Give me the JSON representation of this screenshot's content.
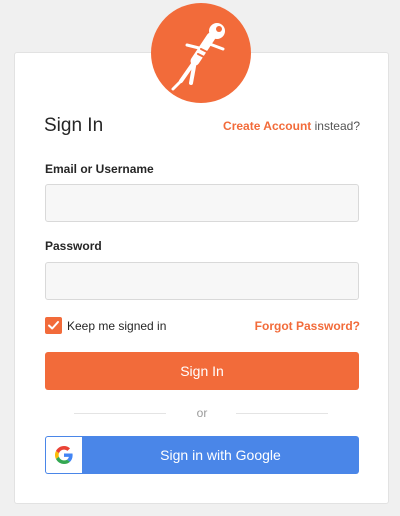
{
  "logo": {
    "icon": "postman-rocketman-icon",
    "color": "#f26b3a"
  },
  "header": {
    "title": "Sign In",
    "create_link": "Create Account",
    "create_suffix": " instead?"
  },
  "form": {
    "email_label": "Email or Username",
    "email_value": "",
    "email_placeholder": "",
    "password_label": "Password",
    "password_value": "",
    "password_placeholder": "",
    "keep_signed_in_label": "Keep me signed in",
    "keep_signed_in_checked": true,
    "forgot_password": "Forgot Password?",
    "submit_label": "Sign In"
  },
  "divider": {
    "text": "or"
  },
  "google": {
    "label": "Sign in with Google",
    "icon": "google-icon"
  },
  "colors": {
    "accent": "#f26b3a",
    "google_blue": "#4a86e8",
    "background": "#f0f0f0",
    "card": "#ffffff"
  }
}
